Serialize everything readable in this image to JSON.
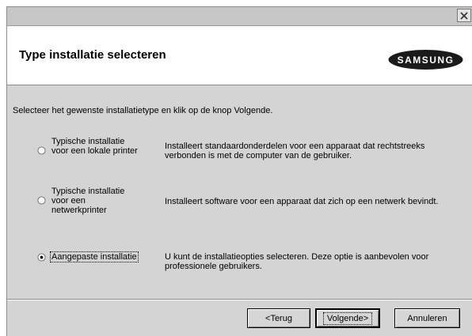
{
  "window": {
    "close_symbol": "✕"
  },
  "header": {
    "title": "Type installatie selecteren",
    "logo_text": "SAMSUNG"
  },
  "instruction": "Selecteer het gewenste installatietype en klik op de knop Volgende.",
  "options": [
    {
      "label_lines": [
        "Typische installatie",
        "voor een lokale printer"
      ],
      "description_lines": [
        "Installeert standaardonderdelen voor een apparaat dat rechtstreeks",
        "verbonden is met de computer van de gebruiker."
      ],
      "selected": false
    },
    {
      "label_lines": [
        "Typische installatie",
        "voor een",
        "netwerkprinter"
      ],
      "description_lines": [
        "Installeert software voor een apparaat dat zich op een netwerk bevindt."
      ],
      "selected": false
    },
    {
      "label_lines": [
        "Aangepaste installatie"
      ],
      "description_lines": [
        "U kunt de installatieopties selecteren. Deze optie is aanbevolen voor",
        "professionele gebruikers."
      ],
      "selected": true
    }
  ],
  "buttons": {
    "back": "<Terug",
    "next": "Volgende>",
    "cancel": "Annuleren"
  },
  "icons": {
    "close": "close-icon",
    "radio": "radio-icon"
  },
  "colors": {
    "dialog_bg": "#d4d4d4",
    "header_bg": "#ffffff"
  }
}
